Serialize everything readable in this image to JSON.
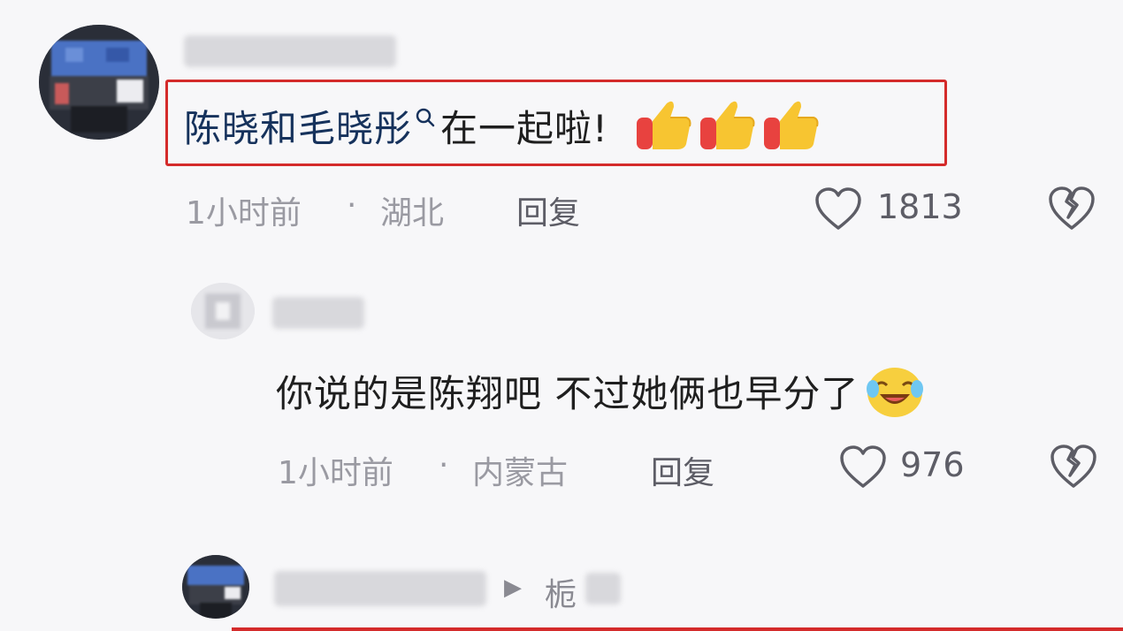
{
  "comment1": {
    "text_before_search": "陈晓和毛晓彤",
    "search_glyph": "search-icon",
    "text_after_search": "在一起啦!",
    "emojis": [
      "thumbs-up-icon",
      "thumbs-up-icon",
      "thumbs-up-icon"
    ],
    "time": "1小时前",
    "sep": "·",
    "location": "湖北",
    "reply_label": "回复",
    "like_count": "1813"
  },
  "comment2": {
    "text": "你说的是陈翔吧 不过她俩也早分了",
    "emoji": "laugh-cry-icon",
    "time": "1小时前",
    "sep": "·",
    "location": "内蒙古",
    "reply_label": "回复",
    "like_count": "976"
  },
  "comment3": {
    "arrow": "▶",
    "partial_name": "栀"
  },
  "colors": {
    "highlight": "#d42b2b",
    "comment1_text": "#16325c",
    "meta_text": "#9a9aa2"
  }
}
